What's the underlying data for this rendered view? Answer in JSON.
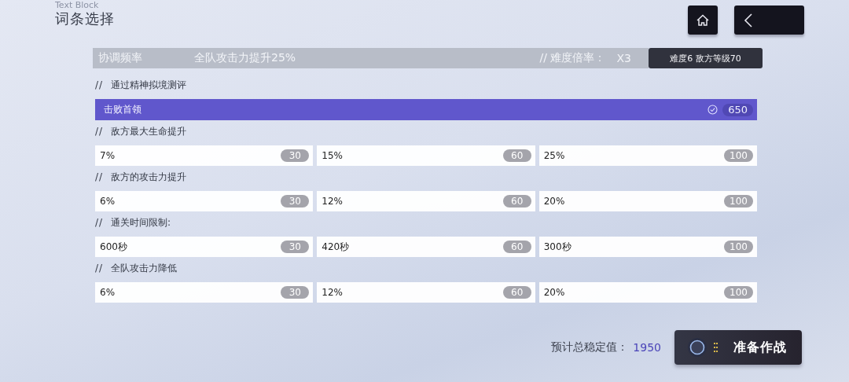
{
  "ghost_label": "Text Block",
  "title": "词条选择",
  "header": {
    "name": "协调频率",
    "effect": "全队攻击力提升25%",
    "multiplier_label": "// 难度倍率：",
    "multiplier": "X3",
    "difficulty": "难度6 敌方等级70"
  },
  "sections": [
    {
      "label": "通过精神拟境测评",
      "kind": "single",
      "options": [
        {
          "text": "击败首领",
          "points": "650",
          "selected": true
        }
      ]
    },
    {
      "label": "敌方最大生命提升",
      "kind": "triple",
      "options": [
        {
          "text": "7%",
          "points": "30",
          "selected": false
        },
        {
          "text": "15%",
          "points": "60",
          "selected": false
        },
        {
          "text": "25%",
          "points": "100",
          "selected": false
        }
      ]
    },
    {
      "label": "敌方的攻击力提升",
      "kind": "triple",
      "options": [
        {
          "text": "6%",
          "points": "30",
          "selected": false
        },
        {
          "text": "12%",
          "points": "60",
          "selected": false
        },
        {
          "text": "20%",
          "points": "100",
          "selected": false
        }
      ]
    },
    {
      "label": "通关时间限制:",
      "kind": "triple",
      "options": [
        {
          "text": "600秒",
          "points": "30",
          "selected": false
        },
        {
          "text": "420秒",
          "points": "60",
          "selected": false
        },
        {
          "text": "300秒",
          "points": "100",
          "selected": false
        }
      ]
    },
    {
      "label": "全队攻击力降低",
      "kind": "triple",
      "options": [
        {
          "text": "6%",
          "points": "30",
          "selected": false
        },
        {
          "text": "12%",
          "points": "60",
          "selected": false
        },
        {
          "text": "20%",
          "points": "100",
          "selected": false
        }
      ]
    }
  ],
  "section_prefix": "//",
  "total": {
    "label": "预计总稳定值：",
    "value": "1950"
  },
  "start_button": "准备作战"
}
